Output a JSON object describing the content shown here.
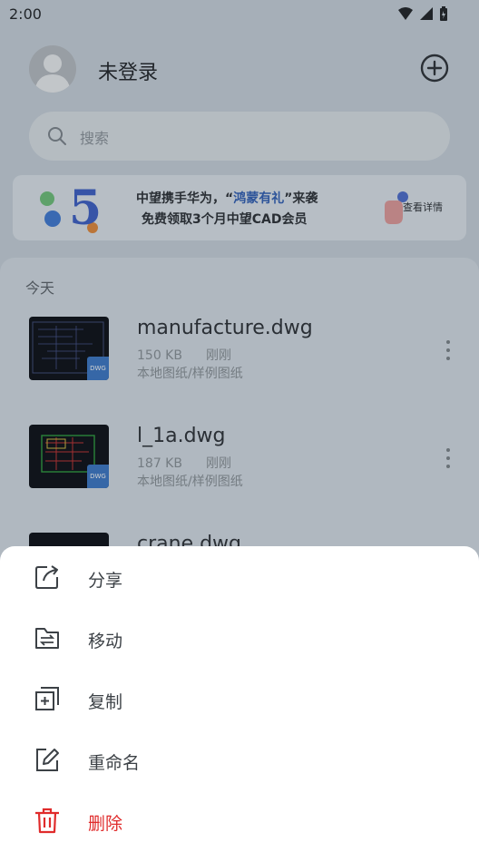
{
  "status_bar": {
    "time": "2:00"
  },
  "header": {
    "login_text": "未登录"
  },
  "search": {
    "placeholder": "搜索"
  },
  "banner": {
    "line1_prefix": "中望携手华为，“",
    "line1_highlight": "鸿蒙有礼",
    "line1_suffix": "”来袭",
    "line2": "免费领取3个月中望CAD会员",
    "detail_label": "查看详情"
  },
  "files": {
    "section_title": "今天",
    "items": [
      {
        "name": "manufacture.dwg",
        "size": "150 KB",
        "time": "刚刚",
        "path": "本地图纸/样例图纸",
        "badge": "DWG"
      },
      {
        "name": "l_1a.dwg",
        "size": "187 KB",
        "time": "刚刚",
        "path": "本地图纸/样例图纸",
        "badge": "DWG"
      },
      {
        "name": "crane.dwg"
      }
    ]
  },
  "actions": [
    {
      "label": "分享",
      "icon": "share-icon"
    },
    {
      "label": "移动",
      "icon": "move-folder-icon"
    },
    {
      "label": "复制",
      "icon": "copy-icon"
    },
    {
      "label": "重命名",
      "icon": "rename-icon"
    },
    {
      "label": "删除",
      "icon": "trash-icon",
      "color": "#e02b2b"
    }
  ]
}
